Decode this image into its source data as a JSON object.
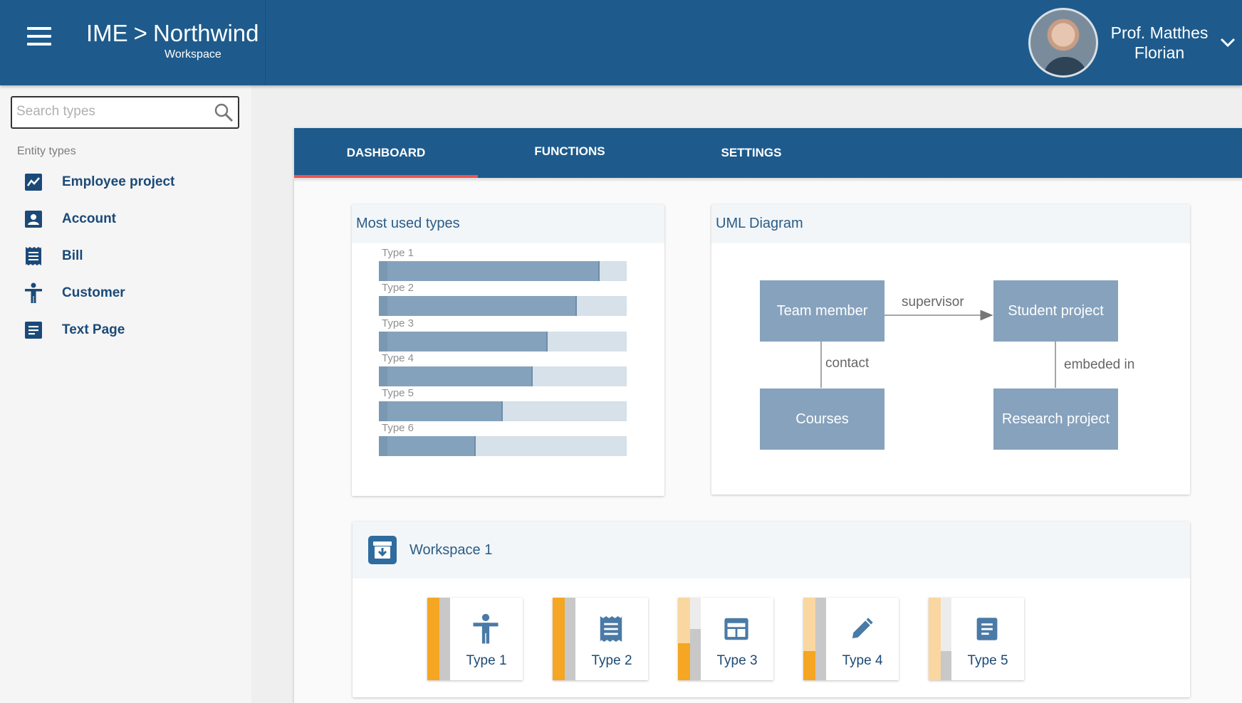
{
  "header": {
    "app": "IME",
    "separator": ">",
    "project": "Northwind",
    "subtitle": "Workspace",
    "user_name": "Prof. Matthes Florian"
  },
  "sidebar": {
    "search_placeholder": "Search types",
    "caption": "Entity types",
    "items": [
      {
        "label": "Employee project",
        "icon": "chart-icon"
      },
      {
        "label": "Account",
        "icon": "account-box-icon"
      },
      {
        "label": "Bill",
        "icon": "receipt-icon"
      },
      {
        "label": "Customer",
        "icon": "person-icon"
      },
      {
        "label": "Text Page",
        "icon": "document-icon"
      }
    ]
  },
  "tabs": [
    {
      "label": "DASHBOARD",
      "active": true
    },
    {
      "label": "FUNCTIONS",
      "active": false
    },
    {
      "label": "SETTINGS",
      "active": false
    }
  ],
  "most_used": {
    "title": "Most used types",
    "chart_data": {
      "type": "bar",
      "orientation": "horizontal",
      "categories": [
        "Type 1",
        "Type 2",
        "Type 3",
        "Type 4",
        "Type 5",
        "Type 6"
      ],
      "values": [
        0.89,
        0.8,
        0.68,
        0.62,
        0.5,
        0.39
      ],
      "xlim": [
        0,
        1
      ],
      "colors": {
        "fill": "#85a2bd",
        "track": "#d6e1ea"
      }
    }
  },
  "uml": {
    "title": "UML Diagram",
    "boxes": {
      "team_member": "Team member",
      "student_project": "Student project",
      "courses": "Courses",
      "research_project": "Research project"
    },
    "relations": {
      "supervisor": "supervisor",
      "contact": "contact",
      "embeded_in": "embeded in"
    }
  },
  "workspace": {
    "title": "Workspace 1",
    "cards": [
      {
        "label": "Type 1",
        "icon": "person-icon",
        "bar_a": 1.0,
        "bar_b": 1.0
      },
      {
        "label": "Type 2",
        "icon": "receipt-icon",
        "bar_a": 1.0,
        "bar_b": 1.0
      },
      {
        "label": "Type 3",
        "icon": "web-layout-icon",
        "bar_a": 0.45,
        "bar_b": 0.62
      },
      {
        "label": "Type 4",
        "icon": "pencil-icon",
        "bar_a": 0.35,
        "bar_b": 1.0
      },
      {
        "label": "Type 5",
        "icon": "document-icon",
        "bar_a": 0.0,
        "bar_b": 0.35
      }
    ]
  },
  "colors": {
    "primary": "#1e5b8c",
    "accent_ink": "#ef5350",
    "orange": "#f5a623",
    "orange_light": "#fad7a0",
    "grey_bar": "#c8c8c8",
    "grey_light": "#ececec"
  }
}
